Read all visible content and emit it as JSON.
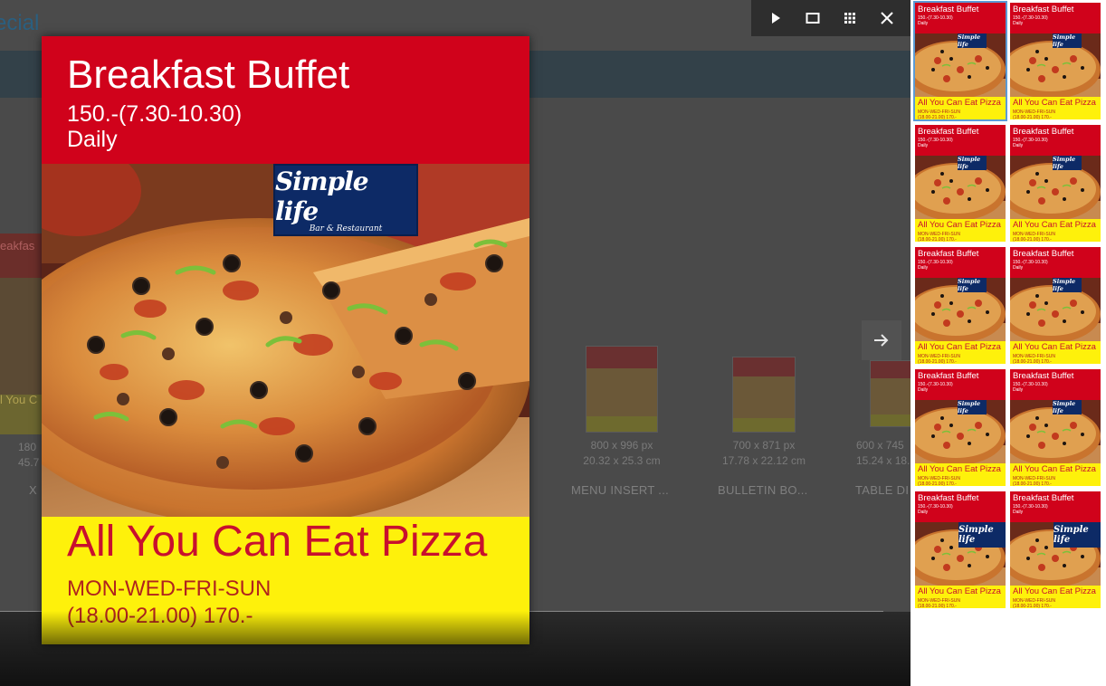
{
  "background_page": {
    "title_fragment": "ecial",
    "left_card_text_top": "eakfas",
    "left_card_text_bottom": "l You C",
    "left_card_dims": [
      "180",
      "45.7"
    ],
    "left_card_label": "X",
    "cards": [
      {
        "dims_px": "800 x 996 px",
        "dims_cm": "20.32 x 25.3 cm",
        "label": "MENU INSERT ..."
      },
      {
        "dims_px": "700 x 871 px",
        "dims_cm": "17.78 x 22.12 cm",
        "label": "BULLETIN BO..."
      },
      {
        "dims_px": "600 x 745",
        "dims_cm": "15.24 x 18.",
        "label": "TABLE DI"
      }
    ]
  },
  "toolbar": {
    "play_icon": "play-icon",
    "fit_icon": "fit-screen-icon",
    "grid_icon": "grid-icon",
    "close_icon": "close-icon"
  },
  "next_arrow_icon": "arrow-right-icon",
  "poster": {
    "title": "Breakfast Buffet",
    "time": "150.-(7.30-10.30)",
    "frequency": "Daily",
    "logo_script": "Simple life",
    "logo_sub": "Bar & Restaurant",
    "headline": "All You Can Eat Pizza",
    "days": "MON-WED-FRI-SUN",
    "price": "(18.00-21.00)  170.-",
    "colors": {
      "header_red": "#d0021b",
      "footer_yellow": "#fef10b",
      "headline_red": "#c8102e",
      "logo_navy": "#0d2a66"
    }
  },
  "thumbnail_text": {
    "title": "Breakfast Buffet",
    "time": "150.-(7.30-10.30)",
    "frequency": "Daily",
    "logo": "Simple life",
    "headline": "All You Can Eat Pizza",
    "days": "MON-WED-FRI-SUN",
    "price": "(18.00-21.00)  170.-"
  },
  "thumbnails_selected_index": 0,
  "selection_color": "#5b9bd5"
}
